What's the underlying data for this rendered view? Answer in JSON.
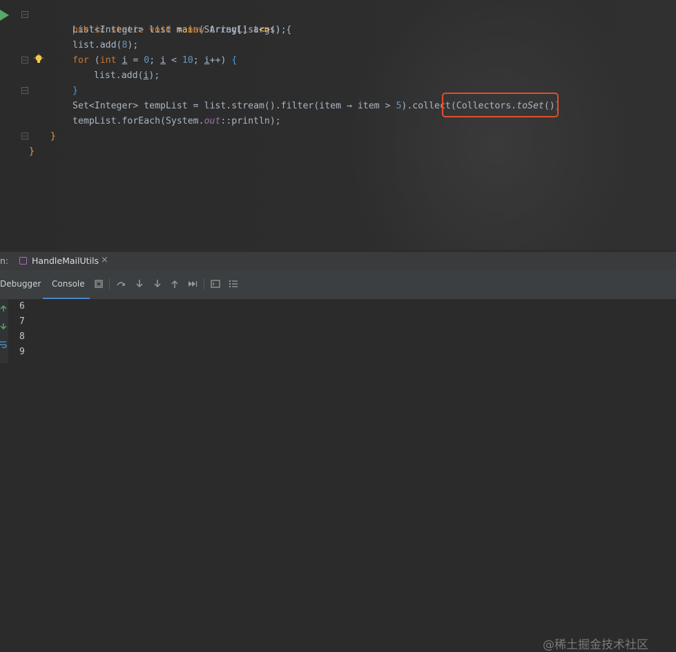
{
  "editor": {
    "code_lines": [
      "public static void main(String[] args) {",
      "List<Integer> list = new ArrayList<>();",
      "list.add(8);",
      "for (int i = 0; i < 10; i++) {",
      "list.add(i);",
      "}",
      "Set<Integer> tempList = list.stream().filter(item → item > 5).collect(Collectors.toSet())",
      "tempList.forEach(System.out::println);",
      "}",
      "}"
    ],
    "highlighted_text": "(Collectors.toSet())"
  },
  "run_panel": {
    "prefix": "n:",
    "tab_label": "HandleMailUtils",
    "tab_close": "×"
  },
  "toolbar": {
    "debugger_label": "Debugger",
    "console_label": "Console"
  },
  "console": {
    "lines": [
      "6",
      "7",
      "8",
      "9"
    ]
  },
  "watermark": "@稀土掘金技术社区",
  "colors": {
    "keyword": "#cc7832",
    "method": "#ffc66d",
    "number": "#6897bb",
    "highlight_border": "#e0502b"
  }
}
